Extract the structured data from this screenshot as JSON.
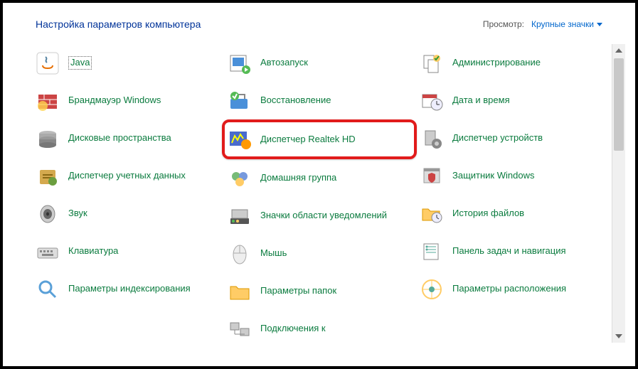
{
  "header": {
    "title": "Настройка параметров компьютера",
    "view_label": "Просмотр:",
    "view_value": "Крупные значки"
  },
  "columns": [
    [
      {
        "icon": "java",
        "label": "Java",
        "dotted": true
      },
      {
        "icon": "firewall",
        "label": "Брандмауэр Windows"
      },
      {
        "icon": "storage",
        "label": "Дисковые пространства"
      },
      {
        "icon": "credential",
        "label": "Диспетчер учетных данных"
      },
      {
        "icon": "sound",
        "label": "Звук"
      },
      {
        "icon": "keyboard",
        "label": "Клавиатура"
      },
      {
        "icon": "indexing",
        "label": "Параметры индексирования"
      }
    ],
    [
      {
        "icon": "autorun",
        "label": "Автозапуск"
      },
      {
        "icon": "recovery",
        "label": "Восстановление"
      },
      {
        "icon": "realtek",
        "label": "Диспетчер Realtek HD",
        "highlight": true
      },
      {
        "icon": "homegroup",
        "label": "Домашняя группа"
      },
      {
        "icon": "tray",
        "label": "Значки области уведомлений"
      },
      {
        "icon": "mouse",
        "label": "Мышь"
      },
      {
        "icon": "folder",
        "label": "Параметры папок"
      },
      {
        "icon": "network",
        "label": "Подключения к"
      }
    ],
    [
      {
        "icon": "admin",
        "label": "Администрирование"
      },
      {
        "icon": "datetime",
        "label": "Дата и время"
      },
      {
        "icon": "device",
        "label": "Диспетчер устройств"
      },
      {
        "icon": "defender",
        "label": "Защитник Windows"
      },
      {
        "icon": "history",
        "label": "История файлов"
      },
      {
        "icon": "taskbar",
        "label": "Панель задач и навигация"
      },
      {
        "icon": "location",
        "label": "Параметры расположения"
      }
    ]
  ]
}
